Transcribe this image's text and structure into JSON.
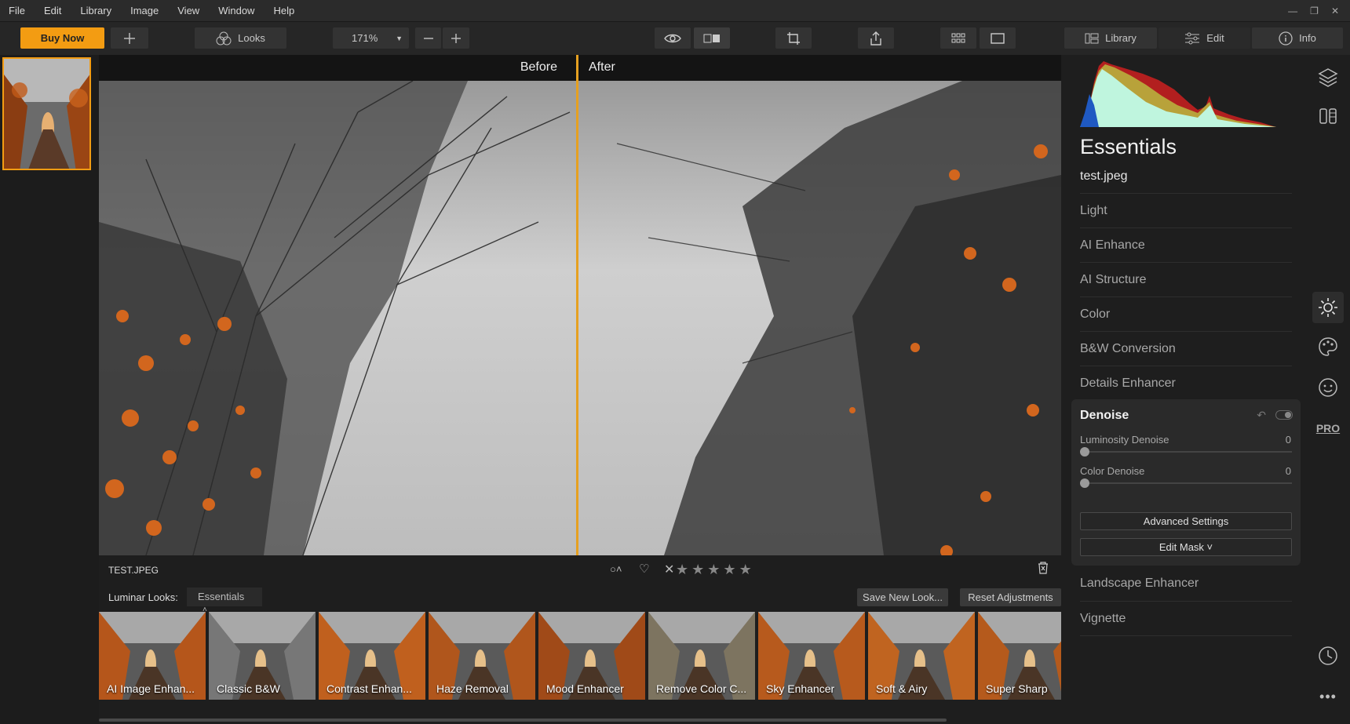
{
  "menu": [
    "File",
    "Edit",
    "Library",
    "Image",
    "View",
    "Window",
    "Help"
  ],
  "toolbar": {
    "buy_label": "Buy Now",
    "looks_label": "Looks",
    "zoom_value": "171%",
    "library_label": "Library",
    "edit_label": "Edit",
    "info_label": "Info"
  },
  "canvas": {
    "before_label": "Before",
    "after_label": "After"
  },
  "infobar": {
    "filename": "TEST.JPEG"
  },
  "looks": {
    "label": "Luminar Looks:",
    "selected": "Essentials",
    "save_label": "Save New Look...",
    "reset_label": "Reset Adjustments",
    "items": [
      {
        "label": "AI Image Enhan..."
      },
      {
        "label": "Classic B&W"
      },
      {
        "label": "Contrast Enhan..."
      },
      {
        "label": "Haze Removal"
      },
      {
        "label": "Mood Enhancer"
      },
      {
        "label": "Remove Color C..."
      },
      {
        "label": "Sky Enhancer"
      },
      {
        "label": "Soft & Airy"
      },
      {
        "label": "Super Sharp"
      }
    ]
  },
  "panel": {
    "title": "Essentials",
    "file": "test.jpeg",
    "tools_top": [
      "Light",
      "AI Enhance",
      "AI Structure",
      "Color",
      "B&W Conversion",
      "Details Enhancer"
    ],
    "denoise": {
      "title": "Denoise",
      "luminosity_label": "Luminosity Denoise",
      "luminosity_value": "0",
      "color_label": "Color Denoise",
      "color_value": "0",
      "advanced_label": "Advanced Settings",
      "mask_label": "Edit Mask ˅"
    },
    "tools_bottom": [
      "Landscape Enhancer",
      "Vignette"
    ]
  },
  "rail": {
    "pro_label": "PRO"
  },
  "colors": {
    "accent": "#f39c12",
    "panel_bg": "#1e1e1e"
  }
}
